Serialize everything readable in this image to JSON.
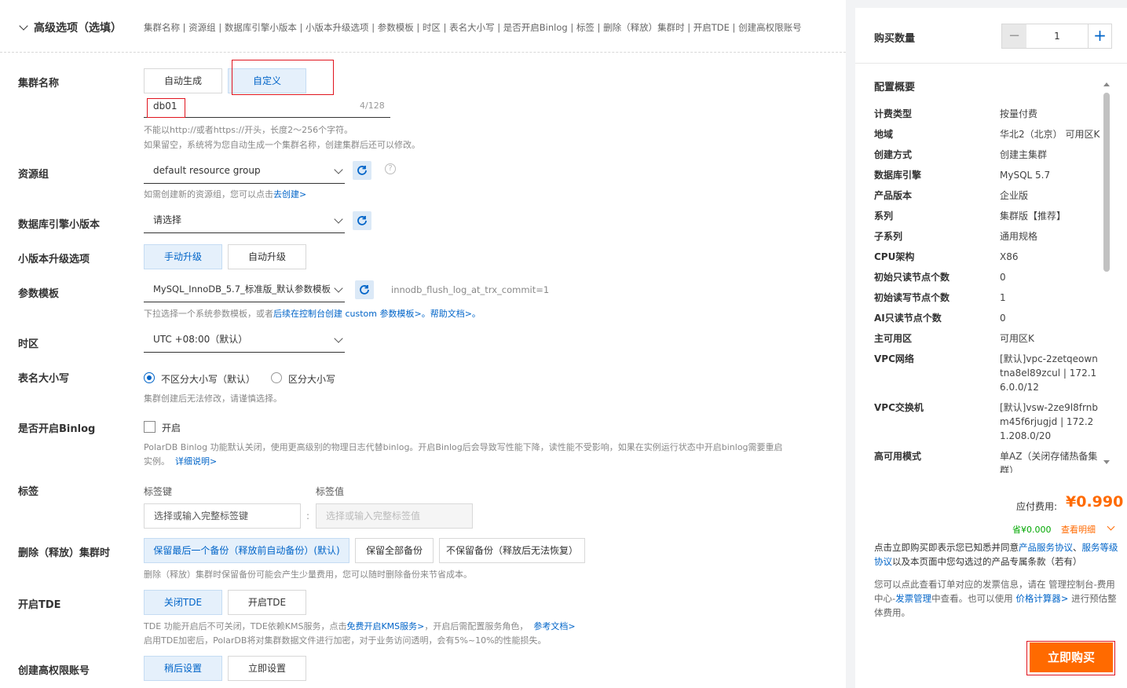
{
  "header": {
    "title": "高级选项（选填）",
    "summary": "集群名称 | 资源组 | 数据库引擎小版本 | 小版本升级选项 | 参数模板 | 时区 | 表名大小写 | 是否开启Binlog | 标签 | 删除（释放）集群时 | 开启TDE | 创建高权限账号"
  },
  "cluster_name": {
    "label": "集群名称",
    "opt_auto": "自动生成",
    "opt_custom": "自定义",
    "value": "db01",
    "counter": "4/128",
    "hint1": "不能以http://或者https://开头，长度2～256个字符。",
    "hint2": "如果留空，系统将为您自动生成一个集群名称，创建集群后还可以修改。"
  },
  "resource_group": {
    "label": "资源组",
    "value": "default resource group",
    "hint": "如需创建新的资源组，您可以点击",
    "hint_link": "去创建>"
  },
  "engine_minor": {
    "label": "数据库引擎小版本",
    "placeholder": "请选择"
  },
  "minor_upgrade": {
    "label": "小版本升级选项",
    "opt_manual": "手动升级",
    "opt_auto": "自动升级"
  },
  "param_template": {
    "label": "参数模板",
    "value": "MySQL_InnoDB_5.7_标准版_默认参数模板",
    "side_note": "innodb_flush_log_at_trx_commit=1",
    "hint": "下拉选择一个系统参数模板，或者",
    "hint_link": "后续在控制台创建 custom 参数模板>。帮助文档>。"
  },
  "timezone": {
    "label": "时区",
    "value": "UTC +08:00（默认）"
  },
  "table_case": {
    "label": "表名大小写",
    "opt_insensitive": "不区分大小写（默认）",
    "opt_sensitive": "区分大小写",
    "hint": "集群创建后无法修改，请谨慎选择。"
  },
  "binlog": {
    "label": "是否开启Binlog",
    "checkbox_label": "开启",
    "hint1": "PolarDB Binlog 功能默认关闭，使用更高级别的物理日志代替binlog。开启Binlog后会导致写性能下降，读性能不受影响，如果在实例运行状态中开启binlog需要重启",
    "hint2": "实例。",
    "hint_link": "详细说明>"
  },
  "tags": {
    "label": "标签",
    "key_label": "标签键",
    "value_label": "标签值",
    "key_placeholder": "选择或输入完整标签键",
    "value_placeholder": "选择或输入完整标签值",
    "separator": ":"
  },
  "delete_policy": {
    "label": "删除（释放）集群时",
    "opt_keep_last": "保留最后一个备份（释放前自动备份）(默认)",
    "opt_keep_all": "保留全部备份",
    "opt_keep_none": "不保留备份（释放后无法恢复）",
    "hint": "删除（释放）集群时保留备份可能会产生少量费用，您可以随时删除备份来节省成本。"
  },
  "tde": {
    "label": "开启TDE",
    "opt_off": "关闭TDE",
    "opt_on": "开启TDE",
    "hint1": "TDE 功能开启后不可关闭，TDE依赖KMS服务，点击",
    "hint1_link": "免费开启KMS服务>",
    "hint1_tail": "，开启后需配置服务角色，",
    "hint1_link2": "参考文档>",
    "hint2": "启用TDE加密后，PolarDB将对集群数据文件进行加密，对于业务访问透明，会有5%~10%的性能损失。"
  },
  "admin_account": {
    "label": "创建高权限账号",
    "opt_later": "稍后设置",
    "opt_now": "立即设置"
  },
  "order": {
    "qty_label": "购买数量",
    "qty_value": "1",
    "minus": "−",
    "plus": "+",
    "overview_title": "配置概要",
    "items": [
      {
        "k": "计费类型",
        "v": "按量付费"
      },
      {
        "k": "地域",
        "v": "华北2（北京） 可用区K"
      },
      {
        "k": "创建方式",
        "v": "创建主集群"
      },
      {
        "k": "数据库引擎",
        "v": "MySQL 5.7"
      },
      {
        "k": "产品版本",
        "v": "企业版"
      },
      {
        "k": "系列",
        "v": "集群版【推荐】"
      },
      {
        "k": "子系列",
        "v": "通用规格"
      },
      {
        "k": "CPU架构",
        "v": "X86"
      },
      {
        "k": "初始只读节点个数",
        "v": "0"
      },
      {
        "k": "初始读写节点个数",
        "v": "1"
      },
      {
        "k": "AI只读节点个数",
        "v": "0"
      },
      {
        "k": "主可用区",
        "v": "可用区K"
      },
      {
        "k": "VPC网络",
        "v": "[默认]vpc-2zetqeowntna8el89zcul | 172.16.0.0/12"
      },
      {
        "k": "VPC交换机",
        "v": "[默认]vsw-2ze9l8frnbm45f6rjugjd | 172.21.208.0/20"
      },
      {
        "k": "高可用模式",
        "v": "单AZ（关闭存储热备集群）"
      }
    ],
    "fee_label": "应付费用:",
    "fee_value": "¥0.990",
    "saved": "省¥0.000",
    "detail_link": "查看明细",
    "agree_text1": "点击立即购买即表示您已知悉并同意",
    "agree_link1": "产品服务协议",
    "agree_sep": "、",
    "agree_link2": "服务等级协议",
    "agree_text2": "以及本页面中您勾选过的产品专属条款（若有）",
    "invoice_text1": "您可以点此查看订单对应的发票信息，请在 管理控制台-费用中心-",
    "invoice_link": "发票管理",
    "invoice_text2": "中查看。也可以使用",
    "calc_link": "价格计算器>",
    "invoice_text3": "进行预估整体费用。",
    "buy_button": "立即购买"
  },
  "colors": {
    "accent": "#0064c8",
    "orange": "#ff6a00",
    "red_highlight": "#e0141e",
    "green": "#00a700"
  }
}
